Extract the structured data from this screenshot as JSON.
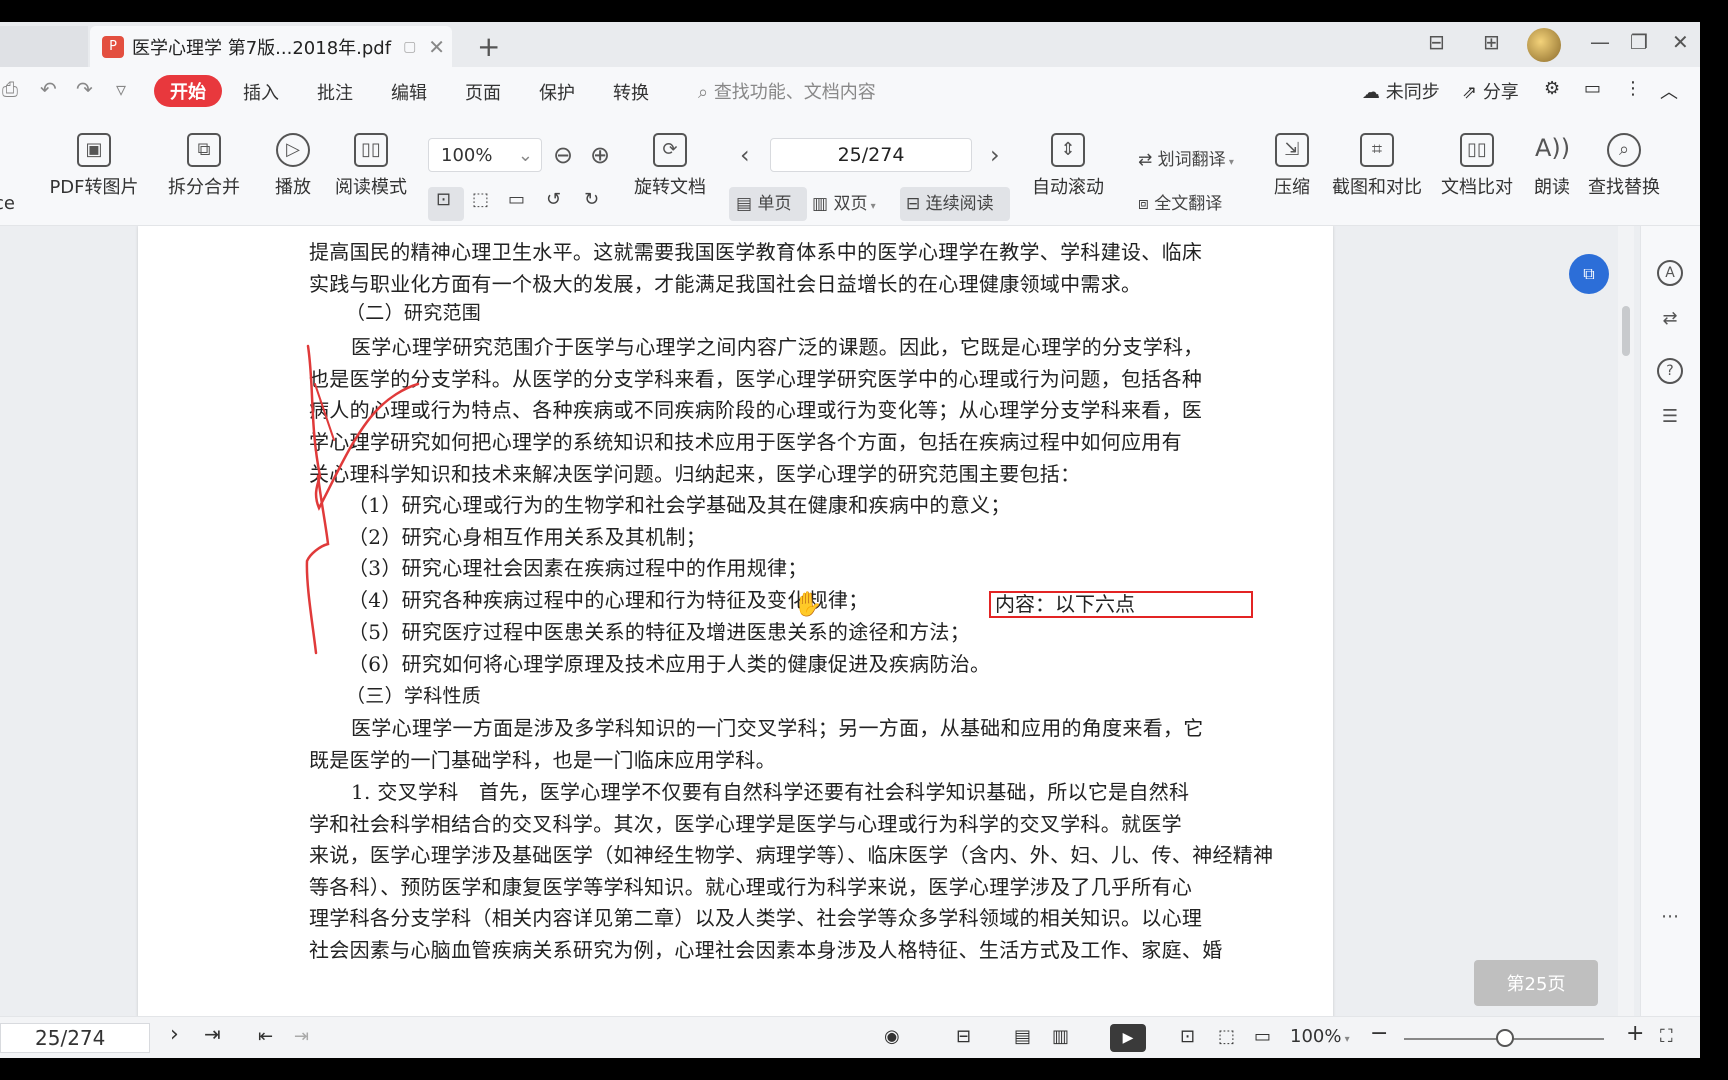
{
  "window": {
    "tab_title": "医学心理学 第7版...2018年.pdf",
    "pdf_badge": "P",
    "new_tab": "+"
  },
  "menu": {
    "active": "开始",
    "items": [
      "插入",
      "批注",
      "编辑",
      "页面",
      "保护",
      "转换"
    ],
    "search_placeholder": "查找功能、文档内容",
    "sync": "未同步",
    "share": "分享"
  },
  "toolbar": {
    "left_stub": "ce",
    "pdf_to_image": "PDF转图片",
    "split_merge": "拆分合并",
    "play": "播放",
    "read_mode": "阅读模式",
    "zoom": "100%",
    "rotate_doc": "旋转文档",
    "page_indicator": "25/274",
    "single_page": "单页",
    "double_page": "双页",
    "continuous_read": "连续阅读",
    "auto_scroll": "自动滚动",
    "word_translate": "划词翻译",
    "full_translate": "全文翻译",
    "compress": "压缩",
    "screenshot_compare": "截图和对比",
    "doc_compare": "文档比对",
    "read_aloud": "朗读",
    "find_replace": "查找替换"
  },
  "document": {
    "lines": [
      "提高国民的精神心理卫生水平。这就需要我国医学教育体系中的医学心理学在教学、学科建设、临床",
      "实践与职业化方面有一个极大的发展，才能满足我国社会日益增长的在心理健康领域中需求。",
      "（二）研究范围",
      "医学心理学研究范围介于医学与心理学之间内容广泛的课题。因此，它既是心理学的分支学科，",
      "也是医学的分支学科。从医学的分支学科来看，医学心理学研究医学中的心理或行为问题，包括各种",
      "病人的心理或行为特点、各种疾病或不同疾病阶段的心理或行为变化等；从心理学分支学科来看，医",
      "学心理学研究如何把心理学的系统知识和技术应用于医学各个方面，包括在疾病过程中如何应用有",
      "关心理科学知识和技术来解决医学问题。归纳起来，医学心理学的研究范围主要包括：",
      "（1）研究心理或行为的生物学和社会学基础及其在健康和疾病中的意义；",
      "（2）研究心身相互作用关系及其机制；",
      "（3）研究心理社会因素在疾病过程中的作用规律；",
      "（4）研究各种疾病过程中的心理和行为特征及变化规律；",
      "（5）研究医疗过程中医患关系的特征及增进医患关系的途径和方法；",
      "（6）研究如何将心理学原理及技术应用于人类的健康促进及疾病防治。",
      "（三）学科性质",
      "医学心理学一方面是涉及多学科知识的一门交叉学科；另一方面，从基础和应用的角度来看，它",
      "既是医学的一门基础学科，也是一门临床应用学科。",
      "1. 交叉学科　首先，医学心理学不仅要有自然科学还要有社会科学知识基础，所以它是自然科",
      "学和社会科学相结合的交叉科学。其次，医学心理学是医学与心理或行为科学的交叉学科。就医学",
      "来说，医学心理学涉及基础医学（如神经生物学、病理学等）、临床医学（含内、外、妇、儿、传、神经精神",
      "等各科）、预防医学和康复医学等学科知识。就心理或行为科学来说，医学心理学涉及了几乎所有心",
      "理学科各分支学科（相关内容详见第二章）以及人类学、社会学等众多学科领域的相关知识。以心理",
      "社会因素与心脑血管疾病关系研究为例，心理社会因素本身涉及人格特征、生活方式及工作、家庭、婚"
    ],
    "annotation": "内容：以下六点",
    "page_badge": "第25页"
  },
  "status": {
    "page": "25/274",
    "zoom": "100%"
  }
}
